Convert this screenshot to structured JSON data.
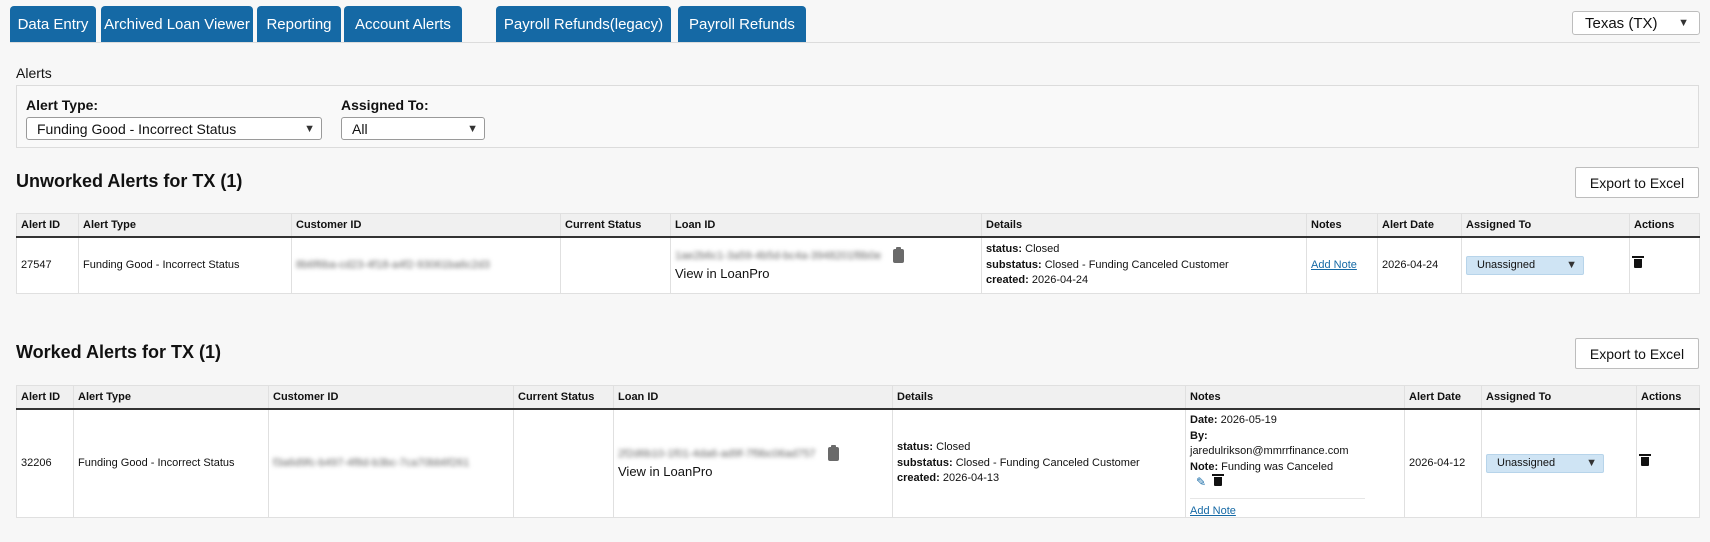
{
  "tabs": [
    {
      "label": "Data Entry"
    },
    {
      "label": "Archived Loan Viewer"
    },
    {
      "label": "Reporting"
    },
    {
      "label": "Account Alerts"
    },
    {
      "label": "Payroll Refunds(legacy)"
    },
    {
      "label": "Payroll Refunds"
    }
  ],
  "state_select": {
    "value": "Texas (TX)"
  },
  "alerts_label": "Alerts",
  "filters": {
    "alert_type_label": "Alert Type:",
    "alert_type_value": "Funding Good - Incorrect Status",
    "assigned_to_label": "Assigned To:",
    "assigned_to_value": "All"
  },
  "unworked": {
    "title": "Unworked Alerts for TX (1)",
    "export_label": "Export to Excel",
    "columns": [
      "Alert ID",
      "Alert Type",
      "Customer ID",
      "Current Status",
      "Loan ID",
      "Details",
      "Notes",
      "Alert Date",
      "Assigned To",
      "Actions"
    ],
    "rows": [
      {
        "alert_id": "27547",
        "alert_type": "Funding Good - Incorrect Status",
        "customer_id": "8b6f6ba-cd23-4f18-a4f2-93061ba6c2d3",
        "current_status": "",
        "loan_id": "1ae2b6c1-3a59-4b5d-bc4a-3948201f8b0e",
        "view_link": "View in LoanPro",
        "details": {
          "status_key": "status:",
          "status_val": "Closed",
          "substatus_key": "substatus:",
          "substatus_val": "Closed - Funding Canceled Customer",
          "created_key": "created:",
          "created_val": "2026-04-24"
        },
        "add_note": "Add Note",
        "alert_date": "2026-04-24",
        "assigned_to": "Unassigned"
      }
    ]
  },
  "worked": {
    "title": "Worked Alerts for TX (1)",
    "export_label": "Export to Excel",
    "columns": [
      "Alert ID",
      "Alert Type",
      "Customer ID",
      "Current Status",
      "Loan ID",
      "Details",
      "Notes",
      "Alert Date",
      "Assigned To",
      "Actions"
    ],
    "rows": [
      {
        "alert_id": "32206",
        "alert_type": "Funding Good - Incorrect Status",
        "customer_id": "f3a6d9fc-b497-4f8d-b3bc-7ca70bb6f261",
        "current_status": "",
        "loan_id": "2f2d6b10-1f01-4da6-ad9f-7f9bc06ad757",
        "view_link": "View in LoanPro",
        "details": {
          "status_key": "status:",
          "status_val": "Closed",
          "substatus_key": "substatus:",
          "substatus_val": "Closed - Funding Canceled Customer",
          "created_key": "created:",
          "created_val": "2026-04-13"
        },
        "note": {
          "date_key": "Date:",
          "date_val": "2026-05-19",
          "by_key": "By:",
          "by_val": "jaredulrikson@mmrrfinance.com",
          "note_key": "Note:",
          "note_val": "Funding was Canceled"
        },
        "add_note": "Add Note",
        "alert_date": "2026-04-12",
        "assigned_to": "Unassigned"
      }
    ]
  }
}
